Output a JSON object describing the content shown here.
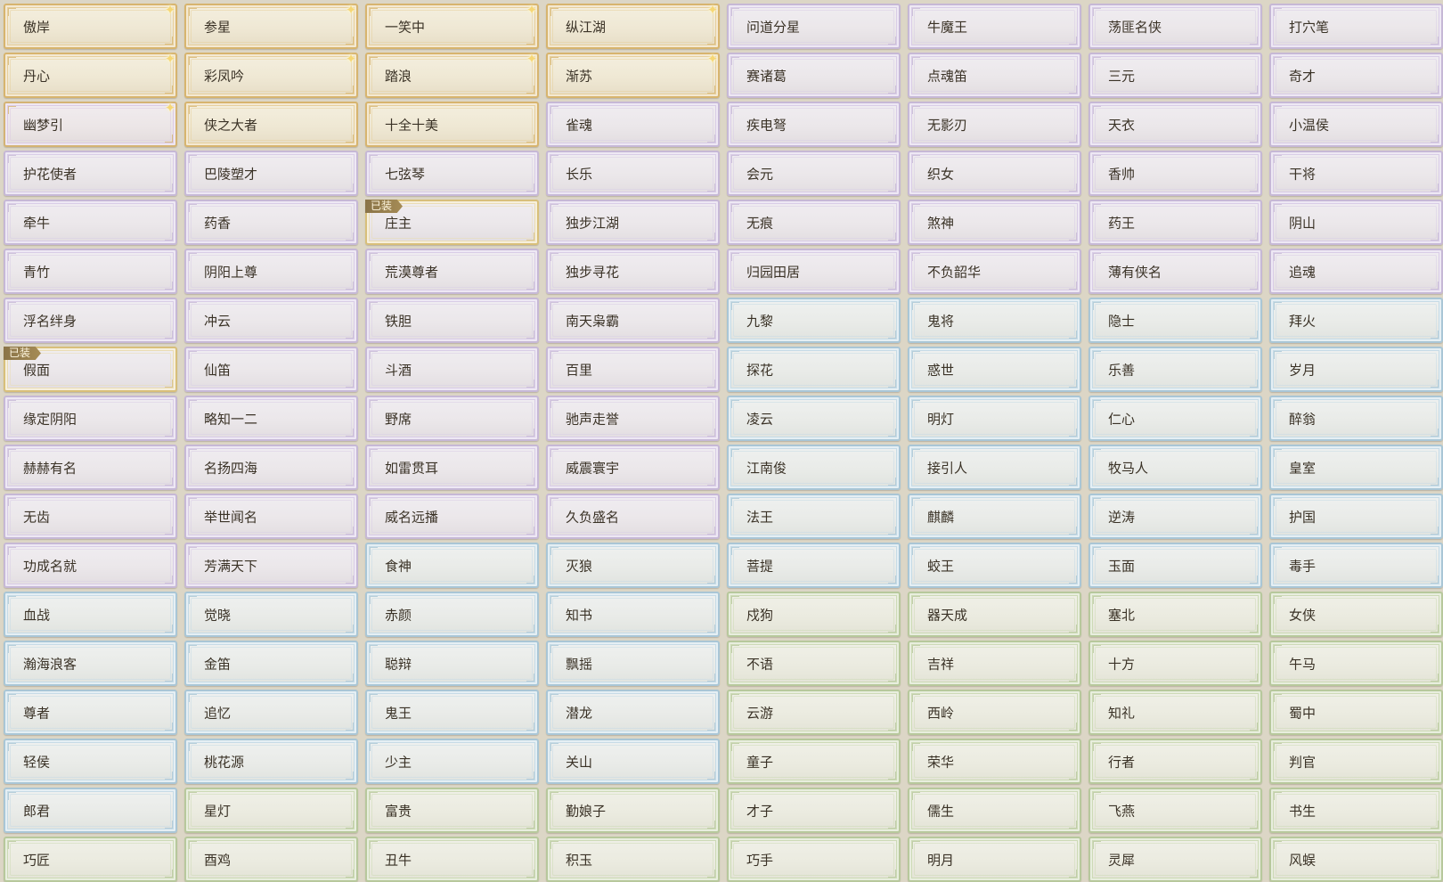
{
  "equipped_badge": "已装",
  "colors": {
    "purple": "#c6b8d6",
    "blue": "#a9c6d6",
    "green": "#b7c89c",
    "gold": "#d7b46e",
    "spark": "#f6d776"
  },
  "titles": [
    {
      "label": "傲岸",
      "rarity": "gold",
      "sparkle": true
    },
    {
      "label": "参星",
      "rarity": "gold",
      "sparkle": true
    },
    {
      "label": "一笑中",
      "rarity": "gold",
      "sparkle": true
    },
    {
      "label": "纵江湖",
      "rarity": "gold",
      "sparkle": true
    },
    {
      "label": "问道分星",
      "rarity": "purple"
    },
    {
      "label": "牛魔王",
      "rarity": "purple"
    },
    {
      "label": "荡匪名侠",
      "rarity": "purple"
    },
    {
      "label": "打穴笔",
      "rarity": "purple"
    },
    {
      "label": "丹心",
      "rarity": "gold",
      "sparkle": true
    },
    {
      "label": "彩凤吟",
      "rarity": "gold",
      "sparkle": true
    },
    {
      "label": "踏浪",
      "rarity": "gold",
      "sparkle": true
    },
    {
      "label": "渐苏",
      "rarity": "gold",
      "sparkle": true
    },
    {
      "label": "赛诸葛",
      "rarity": "purple"
    },
    {
      "label": "点魂笛",
      "rarity": "purple"
    },
    {
      "label": "三元",
      "rarity": "purple"
    },
    {
      "label": "奇才",
      "rarity": "purple"
    },
    {
      "label": "幽梦引",
      "rarity": "gold-purple",
      "sparkle": true
    },
    {
      "label": "侠之大者",
      "rarity": "gold"
    },
    {
      "label": "十全十美",
      "rarity": "gold"
    },
    {
      "label": "雀魂",
      "rarity": "purple"
    },
    {
      "label": "疾电弩",
      "rarity": "purple"
    },
    {
      "label": "无影刃",
      "rarity": "purple"
    },
    {
      "label": "天衣",
      "rarity": "purple"
    },
    {
      "label": "小温侯",
      "rarity": "purple"
    },
    {
      "label": "护花使者",
      "rarity": "purple"
    },
    {
      "label": "巴陵塑才",
      "rarity": "purple"
    },
    {
      "label": "七弦琴",
      "rarity": "purple"
    },
    {
      "label": "长乐",
      "rarity": "purple"
    },
    {
      "label": "会元",
      "rarity": "purple"
    },
    {
      "label": "织女",
      "rarity": "purple"
    },
    {
      "label": "香帅",
      "rarity": "purple"
    },
    {
      "label": "干将",
      "rarity": "purple"
    },
    {
      "label": "牵牛",
      "rarity": "purple"
    },
    {
      "label": "药香",
      "rarity": "purple"
    },
    {
      "label": "庄主",
      "rarity": "purple",
      "equipped": true
    },
    {
      "label": "独步江湖",
      "rarity": "purple"
    },
    {
      "label": "无痕",
      "rarity": "purple"
    },
    {
      "label": "煞神",
      "rarity": "purple"
    },
    {
      "label": "药王",
      "rarity": "purple"
    },
    {
      "label": "阴山",
      "rarity": "purple"
    },
    {
      "label": "青竹",
      "rarity": "purple"
    },
    {
      "label": "阴阳上尊",
      "rarity": "purple"
    },
    {
      "label": "荒漠尊者",
      "rarity": "purple"
    },
    {
      "label": "独步寻花",
      "rarity": "purple"
    },
    {
      "label": "归园田居",
      "rarity": "purple"
    },
    {
      "label": "不负韶华",
      "rarity": "purple"
    },
    {
      "label": "薄有侠名",
      "rarity": "purple"
    },
    {
      "label": "追魂",
      "rarity": "purple"
    },
    {
      "label": "浮名绊身",
      "rarity": "purple"
    },
    {
      "label": "冲云",
      "rarity": "purple"
    },
    {
      "label": "铁胆",
      "rarity": "purple"
    },
    {
      "label": "南天枭霸",
      "rarity": "purple"
    },
    {
      "label": "九黎",
      "rarity": "blue"
    },
    {
      "label": "鬼将",
      "rarity": "blue"
    },
    {
      "label": "隐士",
      "rarity": "blue"
    },
    {
      "label": "拜火",
      "rarity": "blue"
    },
    {
      "label": "假面",
      "rarity": "purple",
      "equipped": true
    },
    {
      "label": "仙笛",
      "rarity": "purple"
    },
    {
      "label": "斗酒",
      "rarity": "purple"
    },
    {
      "label": "百里",
      "rarity": "purple"
    },
    {
      "label": "探花",
      "rarity": "blue"
    },
    {
      "label": "惑世",
      "rarity": "blue"
    },
    {
      "label": "乐善",
      "rarity": "blue"
    },
    {
      "label": "岁月",
      "rarity": "blue"
    },
    {
      "label": "缘定阴阳",
      "rarity": "purple"
    },
    {
      "label": "略知一二",
      "rarity": "purple"
    },
    {
      "label": "野席",
      "rarity": "purple"
    },
    {
      "label": "驰声走誉",
      "rarity": "purple"
    },
    {
      "label": "凌云",
      "rarity": "blue"
    },
    {
      "label": "明灯",
      "rarity": "blue"
    },
    {
      "label": "仁心",
      "rarity": "blue"
    },
    {
      "label": "醉翁",
      "rarity": "blue"
    },
    {
      "label": "赫赫有名",
      "rarity": "purple"
    },
    {
      "label": "名扬四海",
      "rarity": "purple"
    },
    {
      "label": "如雷贯耳",
      "rarity": "purple"
    },
    {
      "label": "威震寰宇",
      "rarity": "purple"
    },
    {
      "label": "江南俊",
      "rarity": "blue"
    },
    {
      "label": "接引人",
      "rarity": "blue"
    },
    {
      "label": "牧马人",
      "rarity": "blue"
    },
    {
      "label": "皇室",
      "rarity": "blue"
    },
    {
      "label": "无齿",
      "rarity": "purple"
    },
    {
      "label": "举世闻名",
      "rarity": "purple"
    },
    {
      "label": "威名远播",
      "rarity": "purple"
    },
    {
      "label": "久负盛名",
      "rarity": "purple"
    },
    {
      "label": "法王",
      "rarity": "blue"
    },
    {
      "label": "麒麟",
      "rarity": "blue"
    },
    {
      "label": "逆涛",
      "rarity": "blue"
    },
    {
      "label": "护国",
      "rarity": "blue"
    },
    {
      "label": "功成名就",
      "rarity": "purple"
    },
    {
      "label": "芳满天下",
      "rarity": "purple"
    },
    {
      "label": "食神",
      "rarity": "blue"
    },
    {
      "label": "灭狼",
      "rarity": "blue"
    },
    {
      "label": "菩提",
      "rarity": "blue"
    },
    {
      "label": "蛟王",
      "rarity": "blue"
    },
    {
      "label": "玉面",
      "rarity": "blue"
    },
    {
      "label": "毒手",
      "rarity": "blue"
    },
    {
      "label": "血战",
      "rarity": "blue"
    },
    {
      "label": "觉晓",
      "rarity": "blue"
    },
    {
      "label": "赤颜",
      "rarity": "blue"
    },
    {
      "label": "知书",
      "rarity": "blue"
    },
    {
      "label": "戍狗",
      "rarity": "green"
    },
    {
      "label": "器天成",
      "rarity": "green"
    },
    {
      "label": "塞北",
      "rarity": "green"
    },
    {
      "label": "女侠",
      "rarity": "green"
    },
    {
      "label": "瀚海浪客",
      "rarity": "blue"
    },
    {
      "label": "金笛",
      "rarity": "blue"
    },
    {
      "label": "聪辩",
      "rarity": "blue"
    },
    {
      "label": "飘摇",
      "rarity": "blue"
    },
    {
      "label": "不语",
      "rarity": "green"
    },
    {
      "label": "吉祥",
      "rarity": "green"
    },
    {
      "label": "十方",
      "rarity": "green"
    },
    {
      "label": "午马",
      "rarity": "green"
    },
    {
      "label": "尊者",
      "rarity": "blue"
    },
    {
      "label": "追忆",
      "rarity": "blue"
    },
    {
      "label": "鬼王",
      "rarity": "blue"
    },
    {
      "label": "潜龙",
      "rarity": "blue"
    },
    {
      "label": "云游",
      "rarity": "green"
    },
    {
      "label": "西岭",
      "rarity": "green"
    },
    {
      "label": "知礼",
      "rarity": "green"
    },
    {
      "label": "蜀中",
      "rarity": "green"
    },
    {
      "label": "轻侯",
      "rarity": "blue"
    },
    {
      "label": "桃花源",
      "rarity": "blue"
    },
    {
      "label": "少主",
      "rarity": "blue"
    },
    {
      "label": "关山",
      "rarity": "blue"
    },
    {
      "label": "童子",
      "rarity": "green"
    },
    {
      "label": "荣华",
      "rarity": "green"
    },
    {
      "label": "行者",
      "rarity": "green"
    },
    {
      "label": "判官",
      "rarity": "green"
    },
    {
      "label": "郎君",
      "rarity": "blue"
    },
    {
      "label": "星灯",
      "rarity": "green"
    },
    {
      "label": "富贵",
      "rarity": "green"
    },
    {
      "label": "勤娘子",
      "rarity": "green"
    },
    {
      "label": "才子",
      "rarity": "green"
    },
    {
      "label": "儒生",
      "rarity": "green"
    },
    {
      "label": "飞燕",
      "rarity": "green"
    },
    {
      "label": "书生",
      "rarity": "green"
    },
    {
      "label": "巧匠",
      "rarity": "green"
    },
    {
      "label": "酉鸡",
      "rarity": "green"
    },
    {
      "label": "丑牛",
      "rarity": "green"
    },
    {
      "label": "积玉",
      "rarity": "green"
    },
    {
      "label": "巧手",
      "rarity": "green"
    },
    {
      "label": "明月",
      "rarity": "green"
    },
    {
      "label": "灵犀",
      "rarity": "green"
    },
    {
      "label": "风蜈",
      "rarity": "green"
    }
  ]
}
